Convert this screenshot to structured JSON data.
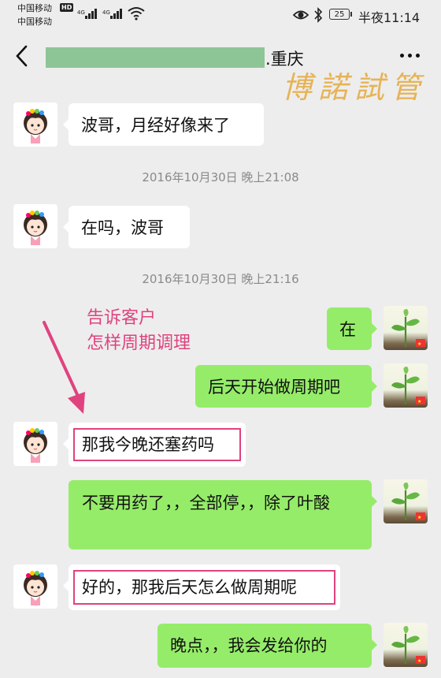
{
  "status_bar": {
    "carrier1": "中国移动",
    "carrier2": "中国移动",
    "hd_badge": "HD",
    "net1": "4G",
    "net2": "4G",
    "battery": "25",
    "time": "半夜11:14"
  },
  "header": {
    "title_suffix": ".重庆",
    "watermark": "博諾試管"
  },
  "annotation": {
    "line1": "告诉客户",
    "line2": "怎样周期调理"
  },
  "messages": [
    {
      "side": "in",
      "text": "波哥，月经好像来了"
    },
    {
      "type": "time",
      "text": "2016年10月30日 晚上21:08"
    },
    {
      "side": "in",
      "text": "在吗，波哥"
    },
    {
      "type": "time",
      "text": "2016年10月30日 晚上21:16"
    },
    {
      "side": "out",
      "text": "在"
    },
    {
      "side": "out",
      "text": "后天开始做周期吧"
    },
    {
      "side": "in",
      "text": "那我今晚还塞药吗",
      "highlight": true
    },
    {
      "side": "out",
      "text": "不要用药了，，全部停，，除了叶酸"
    },
    {
      "side": "in",
      "text": "好的，那我后天怎么做周期呢",
      "highlight": true
    },
    {
      "side": "out",
      "text": "晚点，，我会发给你的"
    }
  ],
  "colors": {
    "background": "#ededed",
    "incoming_bubble": "#ffffff",
    "outgoing_bubble": "#95ec69",
    "highlight": "#e0427f",
    "watermark": "#e6b04e"
  },
  "icons": [
    "back-icon",
    "more-icon",
    "eye-icon",
    "bluetooth-icon",
    "wifi-icon",
    "girl-avatar",
    "plant-avatar"
  ]
}
